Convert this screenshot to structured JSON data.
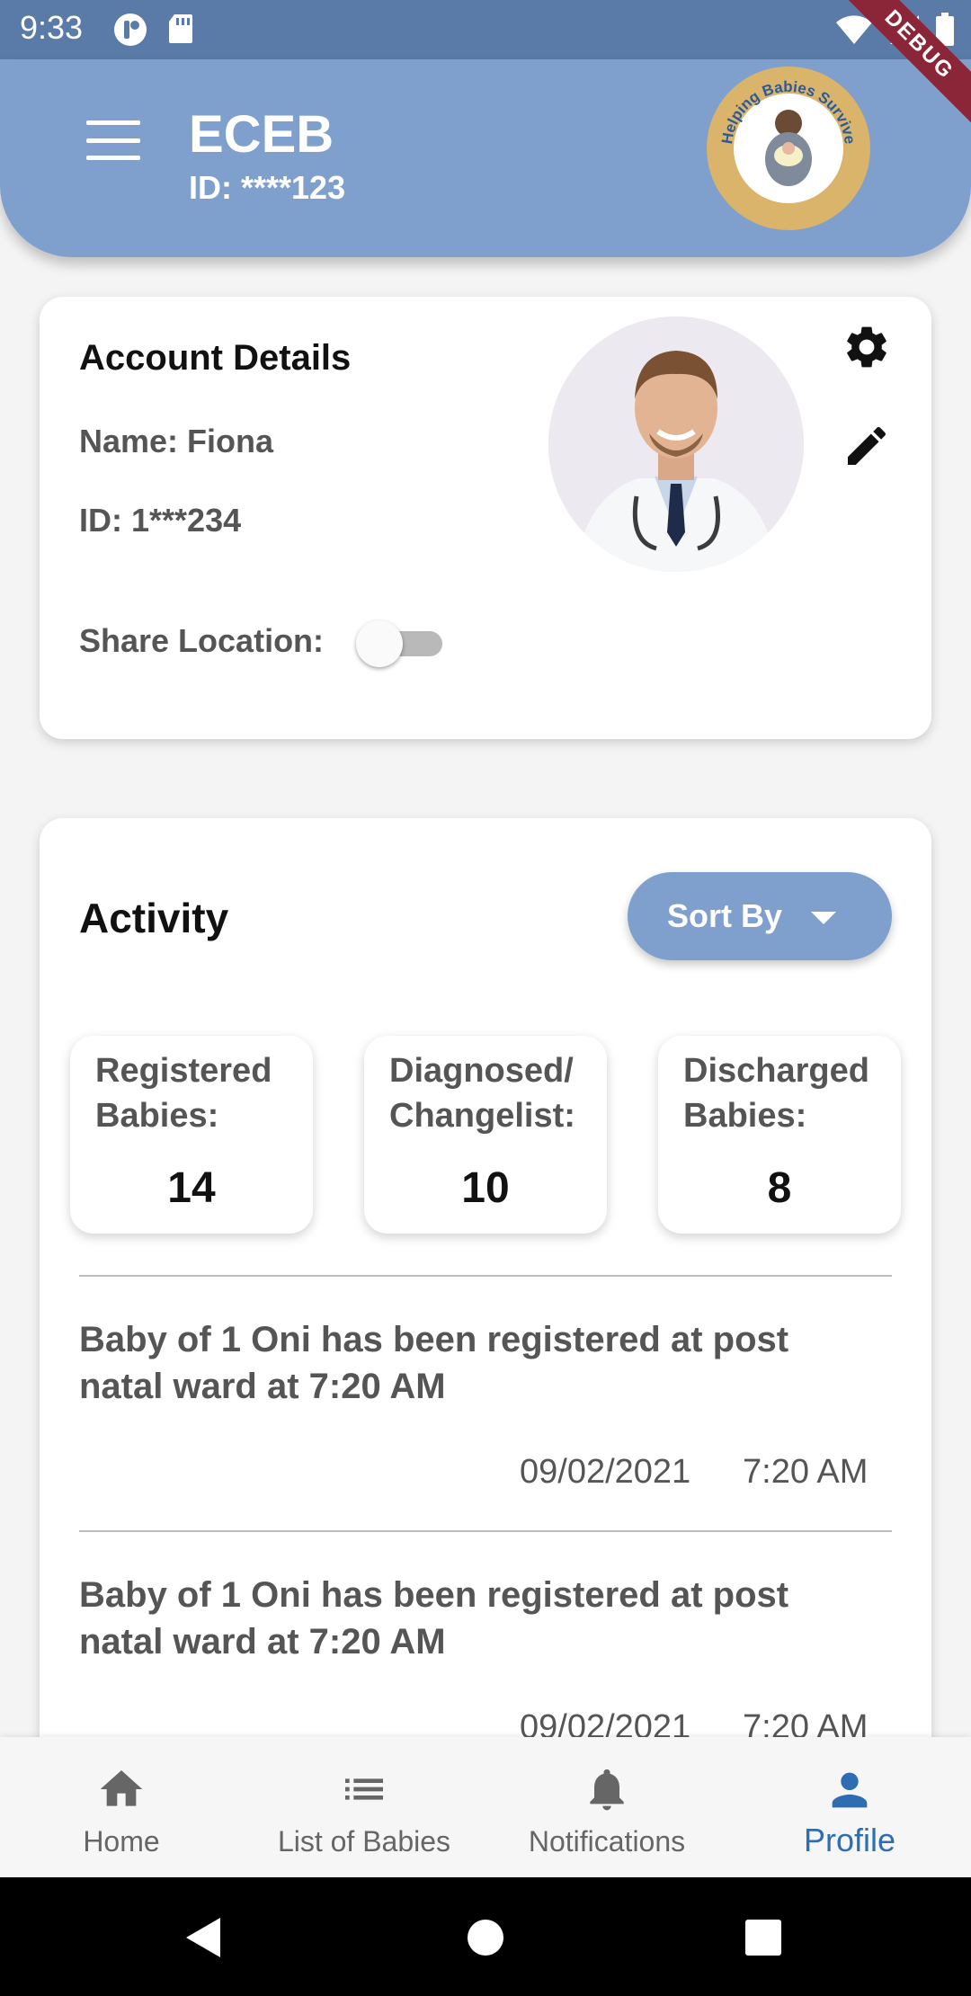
{
  "status_bar": {
    "time": "9:33",
    "left_icons": [
      "notification-app-icon",
      "sd-card-icon"
    ],
    "right_icons": [
      "wifi-icon",
      "signal-icon",
      "battery-icon"
    ]
  },
  "debug_banner": "DEBUG",
  "header": {
    "title": "ECEB",
    "id_text": "ID: ****123",
    "logo_text": "Helping Babies Survive",
    "background_color": "#7f9fcd"
  },
  "account": {
    "title": "Account Details",
    "name": "Name: Fiona",
    "id": "ID: 1***234",
    "share_location_label": "Share Location:",
    "share_location_on": false
  },
  "activity": {
    "title": "Activity",
    "sort_label": "Sort By",
    "stats": [
      {
        "label": "Registered Babies:",
        "value": "14"
      },
      {
        "label": "Diagnosed/ Changelist:",
        "value": "10"
      },
      {
        "label": "Discharged Babies:",
        "value": "8"
      }
    ],
    "feed": [
      {
        "text": "Baby of 1 Oni has been registered at post natal ward at 7:20 AM",
        "date": "09/02/2021",
        "time": "7:20 AM"
      },
      {
        "text": "Baby of 1 Oni has been registered at post natal ward at 7:20 AM",
        "date": "09/02/2021",
        "time": "7:20 AM"
      }
    ]
  },
  "bottom_nav": {
    "items": [
      {
        "label": "Home",
        "icon": "home-icon"
      },
      {
        "label": "List of Babies",
        "icon": "list-icon"
      },
      {
        "label": "Notifications",
        "icon": "bell-icon"
      },
      {
        "label": "Profile",
        "icon": "person-icon"
      }
    ],
    "active_index": 3,
    "active_color": "#2f6db3"
  },
  "system_nav": [
    "back-icon",
    "home-circle-icon",
    "recents-icon"
  ]
}
